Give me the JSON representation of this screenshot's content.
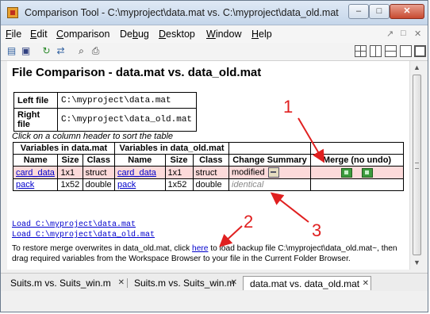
{
  "window": {
    "title": "Comparison Tool - C:\\myproject\\data.mat vs. C:\\myproject\\data_old.mat",
    "minimize": "–",
    "maximize": "□",
    "close": "✕"
  },
  "menu": [
    "File",
    "Edit",
    "Comparison",
    "Debug",
    "Desktop",
    "Window",
    "Help"
  ],
  "menu_right": [
    "↗",
    "□",
    "✕"
  ],
  "toolbar_icons": [
    "new-compare-icon",
    "save-icon",
    "refresh-icon",
    "swap-icon",
    "find-icon",
    "print-icon"
  ],
  "page_title": "File Comparison - data.mat vs. data_old.mat",
  "files": {
    "left_label": "Left file",
    "left_value": "C:\\myproject\\data.mat",
    "right_label": "Right file",
    "right_value": "C:\\myproject\\data_old.mat"
  },
  "hint": "Click on a column header to sort the table",
  "table": {
    "group_left": "Variables in data.mat",
    "group_right": "Variables in data_old.mat",
    "headers": [
      "Name",
      "Size",
      "Class",
      "Name",
      "Size",
      "Class",
      "Change Summary",
      "Merge (no undo)"
    ],
    "rows": [
      {
        "left_name": "card_data",
        "left_size": "1x1",
        "left_class": "struct",
        "right_name": "card_data",
        "right_size": "1x1",
        "right_class": "struct",
        "summary": "modified",
        "diff": true
      },
      {
        "left_name": "pack",
        "left_size": "1x52",
        "left_class": "double",
        "right_name": "pack",
        "right_size": "1x52",
        "right_class": "double",
        "summary": "identical",
        "diff": false
      }
    ]
  },
  "load_links": [
    "Load C:\\myproject\\data.mat",
    "Load C:\\myproject\\data_old.mat"
  ],
  "restore": {
    "before": "To restore merge overwrites in data_old.mat, click ",
    "link": "here",
    "after": " to load backup file C:\\myproject\\data_old.mat~, then drag required variables from the Workspace Browser to your file in the Current Folder Browser."
  },
  "annotations": [
    "1",
    "2",
    "3"
  ],
  "annotation_color": "#e02020",
  "tabs": [
    {
      "label": "Suits.m vs. Suits_win.m",
      "close": "✕",
      "active": false
    },
    {
      "label": "Suits.m vs. Suits_win.m",
      "close": "✕",
      "active": false
    },
    {
      "label": "data.mat vs. data_old.mat",
      "close": "✕",
      "active": true
    }
  ]
}
